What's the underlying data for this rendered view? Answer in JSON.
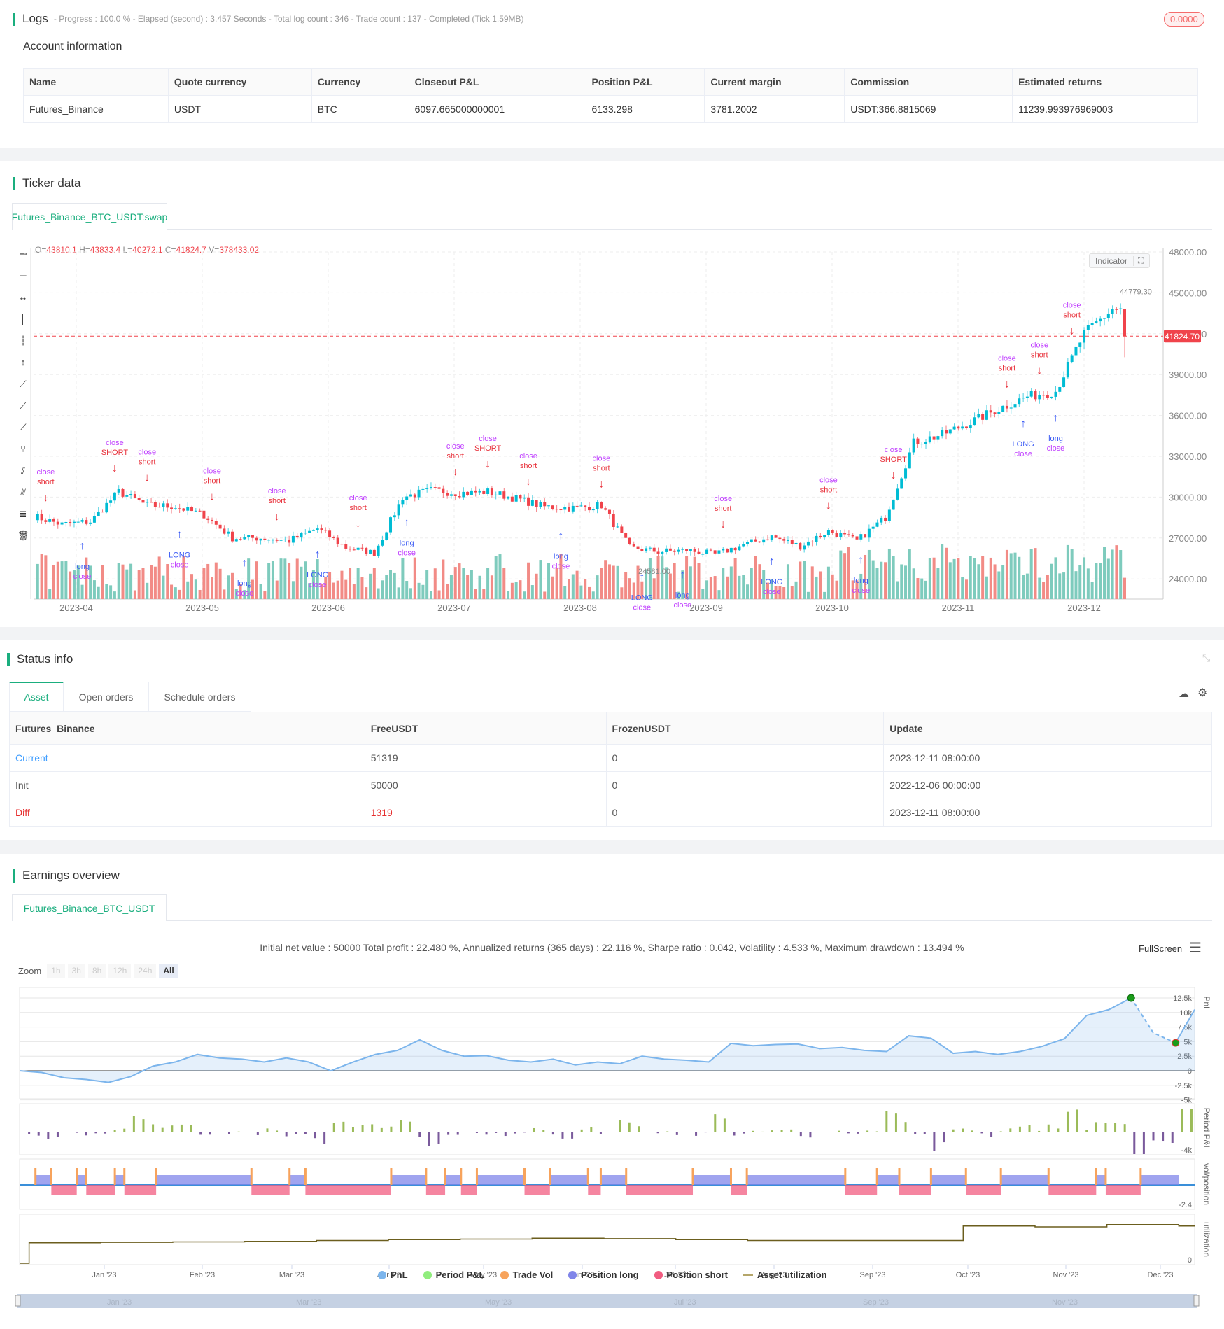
{
  "logs": {
    "title": "Logs",
    "summary": "- Progress : 100.0 % - Elapsed (second) : 3.457  Seconds - Total log count : 346 - Trade count : 137 - Completed (Tick 1.59MB)",
    "badge": "0.0000"
  },
  "account": {
    "title": "Account information",
    "headers": [
      "Name",
      "Quote currency",
      "Currency",
      "Closeout P&L",
      "Position P&L",
      "Current margin",
      "Commission",
      "Estimated returns"
    ],
    "row": [
      "Futures_Binance",
      "USDT",
      "BTC",
      "6097.665000000001",
      "6133.298",
      "3781.2002",
      "USDT:366.8815069",
      "11239.993976969003"
    ]
  },
  "ticker": {
    "title": "Ticker data",
    "tab": "Futures_Binance_BTC_USDT:swap",
    "ohlc": {
      "o_label": "O=",
      "o": "43810.1",
      "h_label": " H=",
      "h": "43833.4",
      "l_label": " L=",
      "l": "40272.1",
      "c_label": " C=",
      "c": "41824.7",
      "v_label": " V=",
      "v": "378433.02"
    },
    "indicator_label": "Indicator",
    "last_price": "41824.70",
    "high_marker": "44779.30",
    "low_marker": "24581.00",
    "colors": {
      "up": "#00bcd4",
      "down": "#f0434b",
      "vol_up": "#7ecbbd",
      "vol_down": "#f28b86"
    }
  },
  "chart_data": [
    {
      "type": "candlestick",
      "title": "Futures_Binance_BTC_USDT:swap",
      "y_ticks": [
        "48000.00",
        "45000.00",
        "42000.00",
        "39000.00",
        "36000.00",
        "33000.00",
        "30000.00",
        "27000.00",
        "24000.00"
      ],
      "ylim": [
        22500,
        48000
      ],
      "x_ticks": [
        "2023-04",
        "2023-05",
        "2023-06",
        "2023-07",
        "2023-08",
        "2023-09",
        "2023-10",
        "2023-11",
        "2023-12"
      ],
      "start_date": "2023-03-22",
      "step_days": 7,
      "weekly_close": [
        28600,
        28000,
        28200,
        30400,
        29400,
        29300,
        28700,
        27000,
        27000,
        26800,
        27700,
        26300,
        25900,
        30000,
        30500,
        30300,
        30400,
        29900,
        29300,
        29200,
        29400,
        26300,
        26000,
        26100,
        25800,
        26500,
        27100,
        26400,
        27500,
        26800,
        28500,
        34000,
        34600,
        35500,
        36500,
        37400,
        37800,
        42000,
        43800
      ],
      "last_candle": {
        "open": 43810.1,
        "high": 43833.4,
        "low": 40272.1,
        "close": 41824.7
      },
      "signal_labels": {
        "short": "short",
        "SHORT": "SHORT",
        "long": "long",
        "LONG": "LONG",
        "close": "close",
        "qty": "1"
      },
      "signals": [
        [
          3,
          "short"
        ],
        [
          12,
          "long"
        ],
        [
          20,
          "SHORT"
        ],
        [
          28,
          "short"
        ],
        [
          36,
          "LONG"
        ],
        [
          44,
          "short"
        ],
        [
          52,
          "long"
        ],
        [
          60,
          "short"
        ],
        [
          70,
          "LONG"
        ],
        [
          80,
          "short"
        ],
        [
          92,
          "long"
        ],
        [
          104,
          "short"
        ],
        [
          112,
          "SHORT"
        ],
        [
          122,
          "short"
        ],
        [
          130,
          "long"
        ],
        [
          140,
          "short"
        ],
        [
          150,
          "LONG"
        ],
        [
          160,
          "long"
        ],
        [
          170,
          "short"
        ],
        [
          182,
          "LONG"
        ],
        [
          196,
          "short"
        ],
        [
          204,
          "long"
        ],
        [
          212,
          "SHORT"
        ],
        [
          240,
          "short"
        ],
        [
          244,
          "LONG"
        ],
        [
          248,
          "short"
        ],
        [
          252,
          "long"
        ],
        [
          256,
          "short"
        ]
      ]
    },
    {
      "type": "line",
      "title": "PnL",
      "series_name": "PnL",
      "start_date": "2022-12-06",
      "step_days": 7,
      "values_k": [
        0,
        -0.3,
        -1.2,
        -1.5,
        -2.0,
        -1.0,
        0.8,
        1.5,
        2.8,
        2.2,
        2.0,
        1.5,
        2.2,
        1.5,
        0,
        1.5,
        2.8,
        3.5,
        5.3,
        3.5,
        2.5,
        2.6,
        1.8,
        1.5,
        2.0,
        1.0,
        1.5,
        1.2,
        2.5,
        2.0,
        1.8,
        1.5,
        4.7,
        4.3,
        4.5,
        4.6,
        3.8,
        4.0,
        3.5,
        3.3,
        6.0,
        5.6,
        3.0,
        3.3,
        2.8,
        3.3,
        4.2,
        5.5,
        9.5,
        10.5,
        12.5,
        6.5,
        4.8,
        10.5
      ],
      "y_ticks": [
        "12.5k",
        "10k",
        "7.5k",
        "5k",
        "2.5k",
        "0",
        "-2.5k",
        "-5k"
      ],
      "ylim": [
        -5,
        12.5
      ],
      "x_ticks": [
        "Jan '23",
        "Feb '23",
        "Mar '23",
        "Apr '23",
        "May '23",
        "Jun '23",
        "Jul '23",
        "Aug '23",
        "Sep '23",
        "Oct '23",
        "Nov '23",
        "Dec '23"
      ]
    },
    {
      "type": "bar",
      "title": "Period P&L",
      "y_ticks": [
        "-4k"
      ]
    },
    {
      "type": "bar",
      "title": "vol/position",
      "y_ticks": [
        "-2.4"
      ]
    },
    {
      "type": "line",
      "title": "utilization",
      "y_ticks": [
        "0"
      ],
      "values": [
        0,
        0.45,
        0.46,
        0.47,
        0.48,
        0.5,
        0.52,
        0.53,
        0.55,
        0.54,
        0.52,
        0.5,
        0.5,
        0.5,
        0.82,
        0.8,
        0.85,
        0.82
      ]
    }
  ],
  "status": {
    "title": "Status info",
    "tabs": [
      "Asset",
      "Open orders",
      "Schedule orders"
    ],
    "headers": [
      "Futures_Binance",
      "FreeUSDT",
      "FrozenUSDT",
      "Update"
    ],
    "rows": [
      [
        "Current",
        "51319",
        "0",
        "2023-12-11 08:00:00"
      ],
      [
        "Init",
        "50000",
        "0",
        "2022-12-06 00:00:00"
      ],
      [
        "Diff",
        "1319",
        "0",
        "2023-12-11 08:00:00"
      ]
    ]
  },
  "earnings": {
    "title": "Earnings overview",
    "tab": "Futures_Binance_BTC_USDT",
    "summary": "Initial net value : 50000 Total profit : 22.480 %, Annualized returns (365 days) : 22.116 %, Sharpe ratio : 0.042, Volatility : 4.533 %, Maximum drawdown : 13.494 %",
    "fullscreen": "FullScreen",
    "zoom_label": "Zoom",
    "zoom_options": [
      "1h",
      "3h",
      "8h",
      "12h",
      "24h",
      "All"
    ],
    "legend": [
      {
        "label": "PnL",
        "color": "#7cb5ec"
      },
      {
        "label": "Period P&L",
        "color": "#90ed7d"
      },
      {
        "label": "Trade Vol",
        "color": "#f7a35c"
      },
      {
        "label": "Position long",
        "color": "#8085e9"
      },
      {
        "label": "Position short",
        "color": "#f15c80"
      },
      {
        "label": "Asset utilization",
        "color": "#b5a66a"
      }
    ],
    "navigator_labels": [
      "Jan '23",
      "Mar '23",
      "May '23",
      "Jul '23",
      "Sep '23",
      "Nov '23"
    ]
  }
}
